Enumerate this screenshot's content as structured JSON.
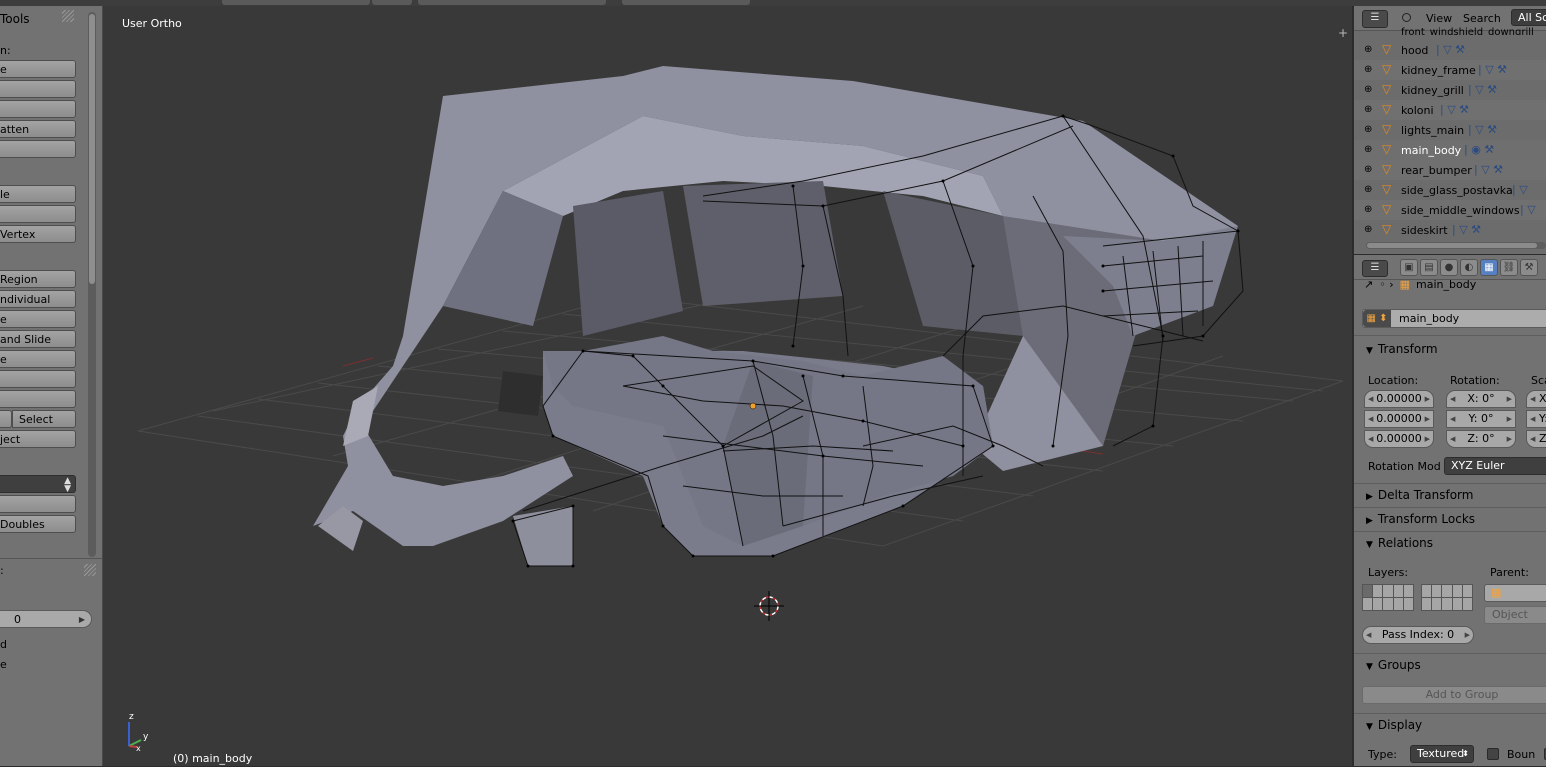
{
  "tool_shelf": {
    "title": "Tools",
    "section_label": "n:",
    "buttons_group1": [
      "e",
      "",
      "",
      "atten",
      ""
    ],
    "buttons_group2": [
      "le",
      "",
      "Vertex"
    ],
    "buttons_group3": [
      "Region",
      "ndividual",
      "e",
      " and Slide",
      "e",
      "",
      ""
    ],
    "select_button": "Select",
    "object_button": "ject",
    "buttons_group4": [
      "",
      "Doubles"
    ],
    "panel2_label": ":",
    "number_field_value": "0",
    "bottom_label1": "d",
    "bottom_label2": "e"
  },
  "viewport": {
    "view_label": "User Ortho",
    "object_label": "(0) main_body",
    "axis_x": "x",
    "axis_y": "y",
    "axis_z": "z",
    "colors": {
      "background": "#393939",
      "mesh_fill": "#7a7c8c",
      "wire": "#111111",
      "grid": "#4a4a4a"
    }
  },
  "outliner": {
    "menu_view": "View",
    "menu_search": "Search",
    "scene_filter": "All Sc",
    "top_item": "front_windshield_downgrill",
    "items": [
      {
        "name": "hood",
        "selected": false
      },
      {
        "name": "kidney_frame",
        "selected": false
      },
      {
        "name": "kidney_grill",
        "selected": false
      },
      {
        "name": "koloni",
        "selected": false
      },
      {
        "name": "lights_main",
        "selected": false
      },
      {
        "name": "main_body",
        "selected": true
      },
      {
        "name": "rear_bumper",
        "selected": false
      },
      {
        "name": "side_glass_postavka",
        "selected": false
      },
      {
        "name": "side_middle_windows",
        "selected": false
      },
      {
        "name": "sideskirt",
        "selected": false
      }
    ]
  },
  "properties": {
    "breadcrumb": "main_body",
    "object_name": "main_body",
    "transform": {
      "header": "Transform",
      "location_label": "Location:",
      "rotation_label": "Rotation:",
      "scale_label": "Sca",
      "location": [
        "0.00000",
        "0.00000",
        "0.00000"
      ],
      "rotation": [
        "X: 0°",
        "Y: 0°",
        "Z: 0°"
      ],
      "scale": [
        "X:",
        "Y:",
        "Z:"
      ],
      "rotation_mode_label": "Rotation Mod",
      "rotation_mode_value": "XYZ Euler"
    },
    "delta_transform": "Delta Transform",
    "transform_locks": "Transform Locks",
    "relations": {
      "header": "Relations",
      "layers_label": "Layers:",
      "parent_label": "Parent:",
      "parent_type": "Object",
      "pass_index": "Pass Index: 0"
    },
    "groups": {
      "header": "Groups",
      "add_button": "Add to Group"
    },
    "display": {
      "header": "Display",
      "type_label": "Type:",
      "type_value": "Textured",
      "bounds_label": "Boun"
    }
  }
}
